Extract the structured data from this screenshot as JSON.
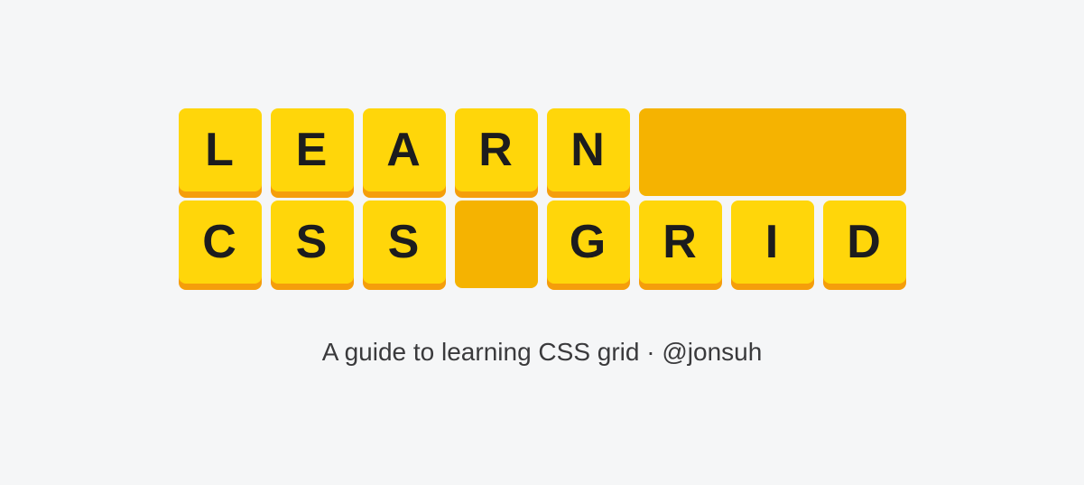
{
  "tiles": {
    "r1c1": "L",
    "r1c2": "E",
    "r1c3": "A",
    "r1c4": "R",
    "r1c5": "N",
    "r2c1": "C",
    "r2c2": "S",
    "r2c3": "S",
    "r2c5": "G",
    "r2c6": "R",
    "r2c7": "I",
    "r2c8": "D"
  },
  "tagline": {
    "text": "A guide to learning CSS grid",
    "separator": " · ",
    "handle": "@jonsuh"
  }
}
